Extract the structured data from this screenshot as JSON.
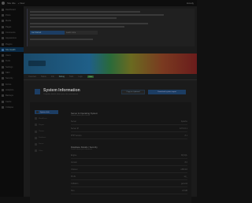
{
  "adminbar": {
    "site_label": "Site title",
    "new_label": "+ New",
    "user_label": "Howdy"
  },
  "sidebar": {
    "items": [
      {
        "label": "Dashboard"
      },
      {
        "label": "Posts"
      },
      {
        "label": "Media"
      },
      {
        "label": "Pages"
      },
      {
        "label": "Comments"
      },
      {
        "label": "Appearance"
      },
      {
        "label": "Plugins"
      },
      {
        "label": "Site Health",
        "active": true
      },
      {
        "label": "Users"
      },
      {
        "label": "Tools"
      },
      {
        "label": "Settings"
      },
      {
        "label": "SEO"
      },
      {
        "label": "Security"
      },
      {
        "label": "Forms"
      },
      {
        "label": "Analytics"
      },
      {
        "label": "Backups"
      },
      {
        "label": "Cache"
      },
      {
        "label": "Collapse"
      }
    ]
  },
  "notice": {
    "button1": "Get Started",
    "button2": "Learn more"
  },
  "tabs": [
    {
      "label": "Overview"
    },
    {
      "label": "Status"
    },
    {
      "label": "Info"
    },
    {
      "label": "Debug",
      "active": true
    },
    {
      "label": "Tools"
    },
    {
      "label": "Logs"
    },
    {
      "label": "New",
      "badge": true
    }
  ],
  "header": {
    "title": "System Information",
    "subtitle": "Complete details about your site environment",
    "copy_button": "Copy to clipboard",
    "download_button": "Download system report"
  },
  "side_nav": [
    {
      "label": "System Info",
      "active": true
    },
    {
      "label": "WordPress"
    },
    {
      "label": "Plugins"
    },
    {
      "label": "Theme"
    },
    {
      "label": "Database"
    },
    {
      "label": "Server"
    },
    {
      "label": "Other"
    }
  ],
  "sections": [
    {
      "title": "Server & Operating System",
      "subtitle": "Details about your server",
      "rows": [
        {
          "label": "Server",
          "value": "Apache"
        },
        {
          "label": "Server IP",
          "value": "127.0.0.1"
        },
        {
          "label": "PHP Version",
          "value": "8.1"
        }
      ]
    },
    {
      "title": "Database Details / Security",
      "subtitle": "Details about your database",
      "rows": [
        {
          "label": "Engine",
          "value": "MySQL"
        },
        {
          "label": "Version",
          "value": "8.0"
        },
        {
          "label": "Charset",
          "value": "utf8mb4"
        },
        {
          "label": "Prefix",
          "value": "wp_"
        },
        {
          "label": "Collation",
          "value": "general"
        },
        {
          "label": "Size",
          "value": "24 MB"
        }
      ]
    }
  ]
}
